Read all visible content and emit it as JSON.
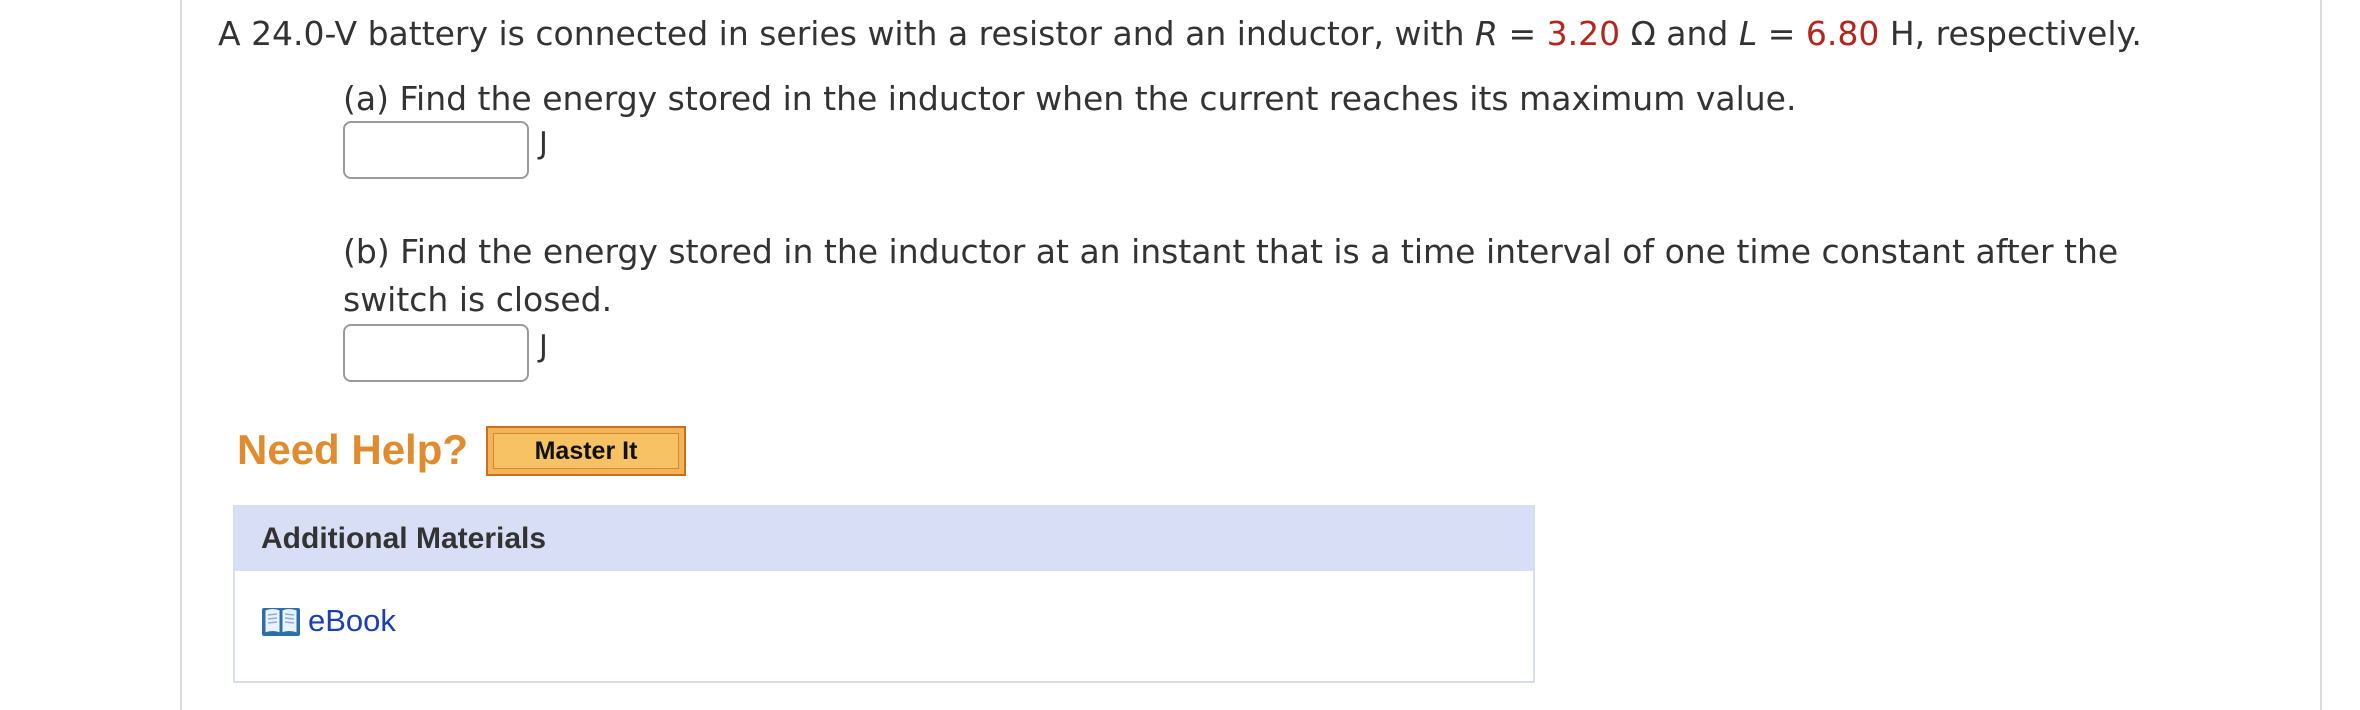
{
  "problem": {
    "intro": "A 24.0-V battery is connected in series with a resistor and an inductor, with ",
    "r_var": "R",
    "eq1": " = ",
    "r_value": "3.20",
    "r_unit": " Ω and ",
    "l_var": "L",
    "eq2": " = ",
    "l_value": "6.80",
    "l_unit": " H, respectively."
  },
  "part_a": {
    "question": "(a) Find the energy stored in the inductor when the current reaches its maximum value.",
    "value": "",
    "unit": "J"
  },
  "part_b": {
    "question": "(b) Find the energy stored in the inductor at an instant that is a time interval of one time constant after the switch is closed.",
    "value": "",
    "unit": "J"
  },
  "help": {
    "label": "Need Help?",
    "master_it": "Master It"
  },
  "additional_materials": {
    "title": "Additional Materials",
    "ebook_label": "eBook",
    "ebook_icon": "book-icon"
  },
  "colors": {
    "given_value": "#b3261e",
    "need_help": "#e08c2e",
    "master_button": "#f2b457",
    "materials_header": "#d8def5",
    "link": "#1a3fb5"
  }
}
